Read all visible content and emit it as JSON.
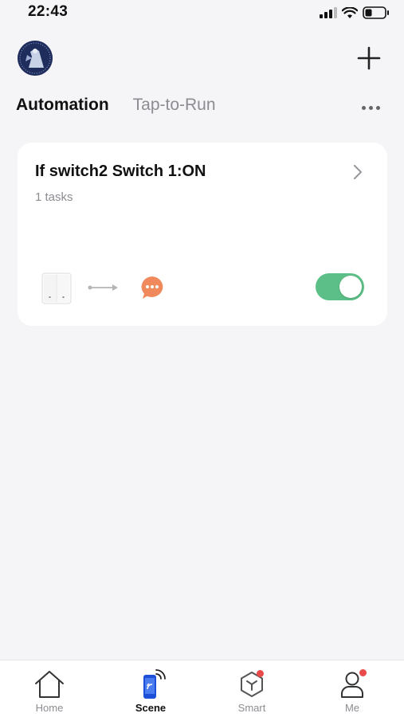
{
  "status_bar": {
    "time": "22:43",
    "icons": [
      "cellular-signal-icon",
      "wifi-icon",
      "battery-icon"
    ]
  },
  "header": {
    "avatar": "avatar-image",
    "add_icon": "plus-icon",
    "more_icon": "more-horizontal-icon"
  },
  "tabs": [
    {
      "label": "Automation",
      "active": true
    },
    {
      "label": "Tap-to-Run",
      "active": false
    }
  ],
  "automation_card": {
    "title": "If switch2 Switch 1:ON",
    "tasks": "1 tasks",
    "enabled": true,
    "colors": {
      "toggle_on": "#5cbf87",
      "message": "#f08a5d"
    }
  },
  "bottom_nav": {
    "items": [
      {
        "label": "Home",
        "icon": "home-icon",
        "active": false,
        "badge": false
      },
      {
        "label": "Scene",
        "icon": "scene-icon",
        "active": true,
        "badge": false
      },
      {
        "label": "Smart",
        "icon": "smart-cube-icon",
        "active": false,
        "badge": true
      },
      {
        "label": "Me",
        "icon": "person-icon",
        "active": false,
        "badge": true
      }
    ]
  }
}
